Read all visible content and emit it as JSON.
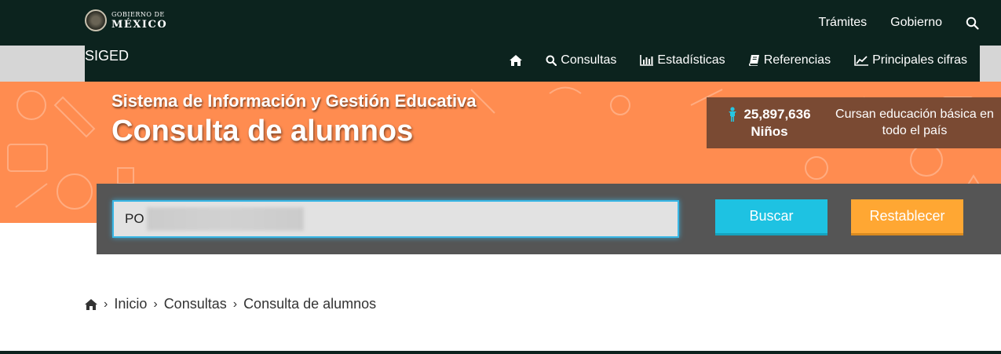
{
  "gov_header": {
    "logo_top": "GOBIERNO DE",
    "logo_bottom": "MÉXICO",
    "nav": {
      "tramites": "Trámites",
      "gobierno": "Gobierno"
    }
  },
  "siged_nav": {
    "title": "SIGED",
    "items": [
      {
        "label": "Consultas",
        "icon": "search-icon"
      },
      {
        "label": "Estadísticas",
        "icon": "bar-chart-icon"
      },
      {
        "label": "Referencias",
        "icon": "book-icon"
      },
      {
        "label": "Principales cifras",
        "icon": "line-chart-icon"
      }
    ],
    "home_icon": "home-icon"
  },
  "hero": {
    "subtitle": "Sistema de Información y Gestión Educativa",
    "title": "Consulta de alumnos",
    "stats": {
      "count": "25,897,636",
      "unit": "Niños",
      "description": "Cursan educación básica en todo el país"
    }
  },
  "search": {
    "value": "PO",
    "buscar_label": "Buscar",
    "reset_label": "Restablecer"
  },
  "breadcrumb": {
    "items": [
      "Inicio",
      "Consultas",
      "Consulta de alumnos"
    ]
  },
  "colors": {
    "header_bg": "#0c231e",
    "hero_bg": "#ff8c50",
    "buscar": "#1ec2e2",
    "reset": "#ffa733",
    "panel": "#555555"
  }
}
